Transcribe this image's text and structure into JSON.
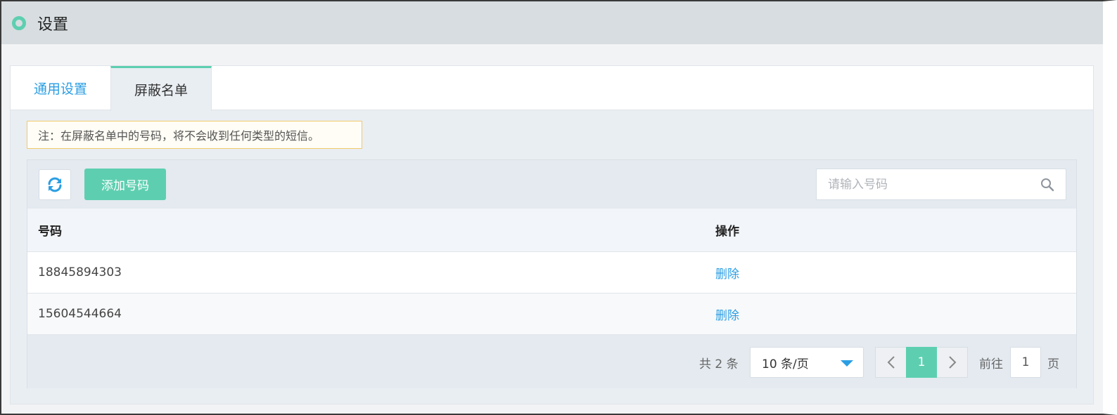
{
  "header": {
    "title": "设置"
  },
  "tabs": [
    {
      "label": "通用设置",
      "active": false
    },
    {
      "label": "屏蔽名单",
      "active": true
    }
  ],
  "notice": "注：在屏蔽名单中的号码，将不会收到任何类型的短信。",
  "toolbar": {
    "refresh_icon": "refresh-icon",
    "add_label": "添加号码",
    "search_placeholder": "请输入号码",
    "search_value": ""
  },
  "table": {
    "headers": [
      "号码",
      "操作"
    ],
    "rows": [
      {
        "number": "18845894303",
        "action": "删除"
      },
      {
        "number": "15604544664",
        "action": "删除"
      }
    ]
  },
  "pagination": {
    "total": "共 2 条",
    "page_size": "10 条/页",
    "current_page": "1",
    "goto_label": "前往",
    "goto_value": "1",
    "page_suffix": "页"
  },
  "colors": {
    "accent": "#5dcfb0",
    "link": "#2b9ee3",
    "notice_border": "#f1c96b"
  }
}
